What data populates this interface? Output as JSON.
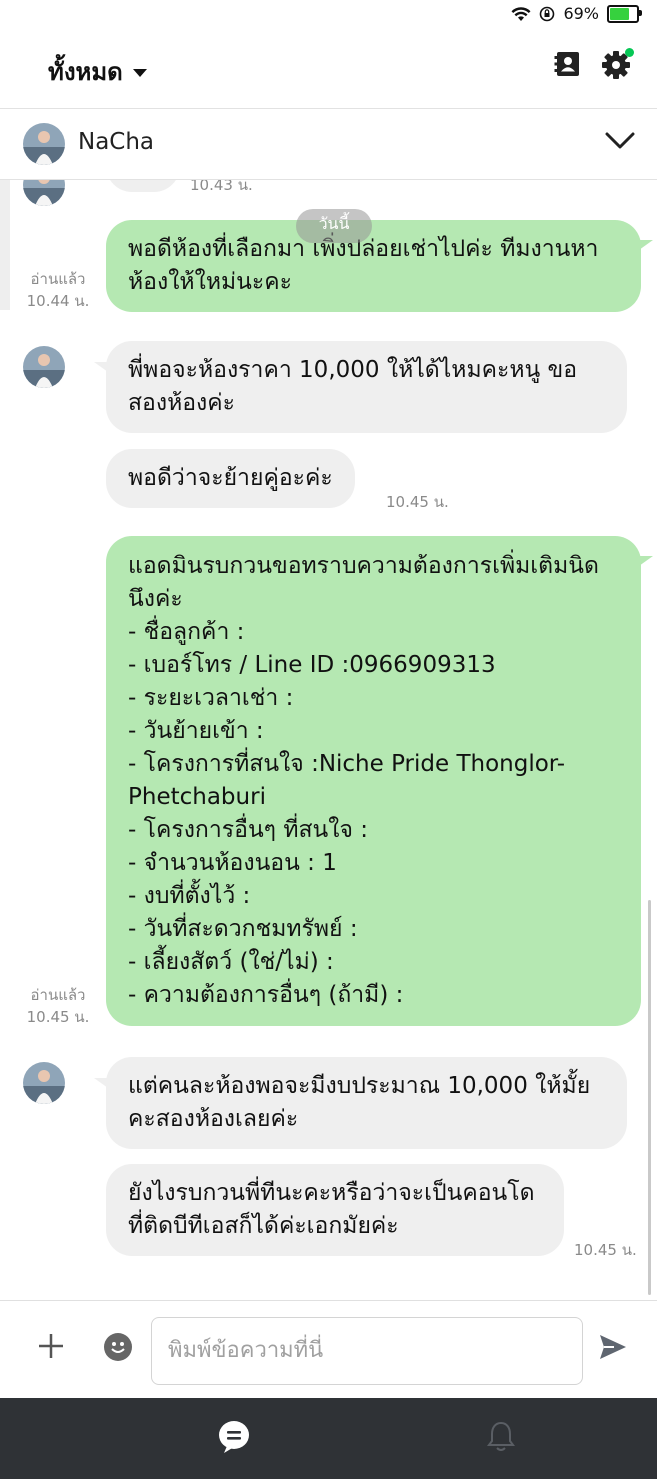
{
  "status": {
    "battery": "69%",
    "battery_level": 0.69
  },
  "header": {
    "filter_label": "ทั้งหมด",
    "contacts_icon": "contacts-icon",
    "settings_icon": "gear-icon",
    "settings_badge_color": "#06c755"
  },
  "conversation": {
    "name": "NaCha"
  },
  "messages": {
    "partial_time": "10.43 น.",
    "date_pill": "วันนี้",
    "m1": {
      "text": "พอดีห้องที่เลือกมา เพิ่งปล่อยเช่าไปค่ะ ทีมงานหาห้องให้ใหม่นะคะ",
      "read": "อ่านแล้ว",
      "time": "10.44 น."
    },
    "m2": {
      "text": "พี่พอจะห้องราคา 10,000 ให้ได้ไหมคะหนู ขอสองห้องค่ะ"
    },
    "m3": {
      "text": "พอดีว่าจะย้ายคู่อะค่ะ",
      "time": "10.45 น."
    },
    "m4": {
      "lines": [
        "แอดมินรบกวนขอทราบความต้องการเพิ่มเติมนิดนึงค่ะ",
        "- ชื่อลูกค้า :",
        "- เบอร์โทร / Line ID :0966909313",
        "- ระยะเวลาเช่า :",
        "- วันย้ายเข้า :",
        "- โครงการที่สนใจ :Niche Pride Thonglor-Phetchaburi",
        "- โครงการอื่นๆ ที่สนใจ :",
        "- จำนวนห้องนอน : 1",
        "- งบที่ตั้งไว้ :",
        "- วันที่สะดวกชมทรัพย์ :",
        "- เลี้ยงสัตว์ (ใช่/ไม่) :",
        "- ความต้องการอื่นๆ (ถ้ามี) :"
      ],
      "read": "อ่านแล้ว",
      "time": "10.45 น."
    },
    "m5": {
      "text": "แต่คนละห้องพอจะมีงบประมาณ 10,000 ให้มั้ยคะสองห้องเลยค่ะ"
    },
    "m6": {
      "text": "ยังไงรบกวนพี่ทีนะคะหรือว่าจะเป็นคอนโดที่ติดบีทีเอสก็ได้ค่ะเอกมัยค่ะ",
      "time": "10.45 น."
    }
  },
  "input": {
    "placeholder": "พิมพ์ข้อความที่นี่"
  },
  "colors": {
    "outgoing_bubble": "#b5e8b2",
    "incoming_bubble": "#efefef",
    "bottom_nav": "#2f3236"
  }
}
